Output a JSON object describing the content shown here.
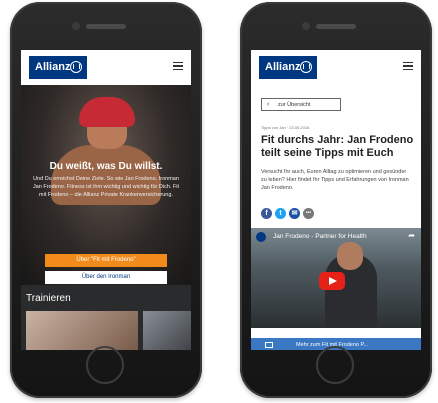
{
  "brand": {
    "logo_text": "Allianz",
    "color": "#003781"
  },
  "left_screen": {
    "hero": {
      "title": "Du weißt, was Du willst.",
      "text": "Und Du erreichst Deine Ziele. So wie Jan Frodeno, Ironman Jan Frodeno. Fitness ist ihm wichtig und wichtig für Dich. Fit mit Frodeno – die Allianz Private Krankenversicherung.",
      "primary_button": "Über \"Fit mit Frodeno\"",
      "secondary_button": "Über den Ironman"
    },
    "section_title": "Trainieren"
  },
  "right_screen": {
    "back_button": "zur Übersicht",
    "meta": "Tipps von Jan · 23.05.2018",
    "article_title": "Fit durchs Jahr: Jan Frodeno teilt seine Tipps mit Euch",
    "intro": "Versucht Ihr auch, Euren Alltag zu optimieren und gesünder zu leben? Hier findet Ihr Tipps und Erfahrungen von Ironman Jan Frodeno.",
    "social": [
      {
        "name": "facebook",
        "glyph": "f",
        "color": "#3b5998"
      },
      {
        "name": "twitter",
        "glyph": "t",
        "color": "#1da1f2"
      },
      {
        "name": "email",
        "glyph": "✉",
        "color": "#1d4fa3"
      },
      {
        "name": "more",
        "glyph": "•••",
        "color": "#777777"
      }
    ],
    "video_title": "Jan Frodeno - Partner for Health",
    "cta_text": "Mehr zum Fit mit Frodeno P..."
  },
  "icons": {
    "menu": "hamburger-icon",
    "back": "chevron-left-icon",
    "play": "play-icon",
    "share": "share-icon"
  },
  "colors": {
    "accent_orange": "#f28b1c",
    "youtube_red": "#e62117",
    "cta_blue": "#3b78c4"
  }
}
